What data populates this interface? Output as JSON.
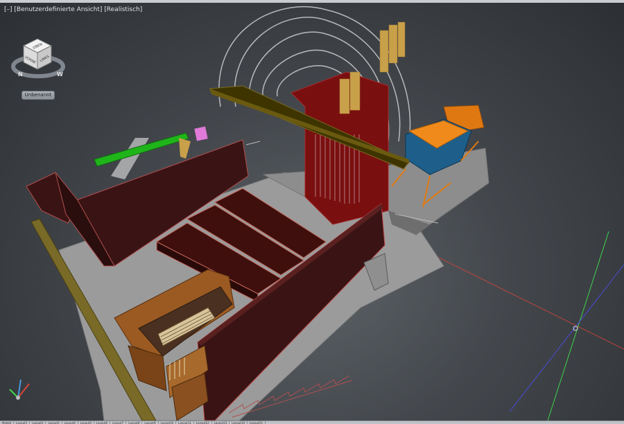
{
  "viewport": {
    "control_label": "[–]",
    "view_label": "[Benutzerdefinierte Ansicht]",
    "style_label": "[Realistisch]"
  },
  "viewcube": {
    "top_face": "OBEN",
    "front_face": "VORNE",
    "right_face": "LINKS",
    "compass_n": "N",
    "compass_w": "W"
  },
  "wcs_button": "Unbenannt",
  "layout_tabs": [
    "Modell",
    "Layout1",
    "Layout2",
    "Layout3",
    "Layout4",
    "Layout5",
    "Layout6",
    "Layout7",
    "Layout8",
    "Layout9",
    "Layout10",
    "Layout11",
    "Layout12",
    "Layout13",
    "Layout14",
    "Layout15"
  ],
  "colors": {
    "background": "#43474c",
    "floor": "#9a9a9a",
    "wall": "#3a1414",
    "stage": "#4a1a12",
    "beam": "#3b3300",
    "organ_case": "#8a4a1e",
    "grid_x": "#d9453a",
    "grid_y": "#3fd44a",
    "grid_z": "#4a4ad9"
  }
}
